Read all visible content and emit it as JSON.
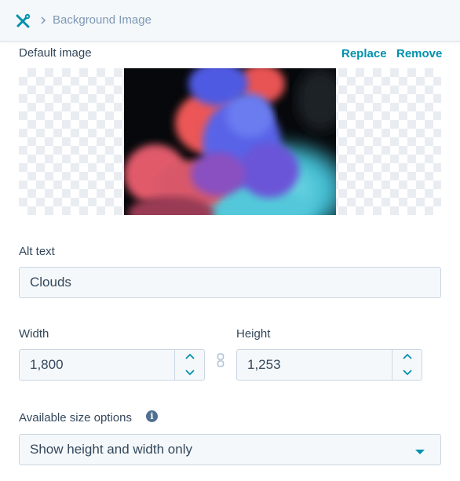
{
  "header": {
    "breadcrumb": "Background Image"
  },
  "image_section": {
    "label": "Default image",
    "replace": "Replace",
    "remove": "Remove"
  },
  "alt_text": {
    "label": "Alt text",
    "value": "Clouds"
  },
  "width": {
    "label": "Width",
    "value": "1,800"
  },
  "height": {
    "label": "Height",
    "value": "1,253"
  },
  "size_options": {
    "label": "Available size options",
    "selected": "Show height and width only"
  },
  "colors": {
    "accent": "#0091ae",
    "text": "#33475b",
    "muted": "#7c98b6",
    "field_bg": "#f5f8fa",
    "border": "#cbd6e2"
  },
  "icons": [
    "tools-icon",
    "chevron-right-icon",
    "link-icon",
    "chevron-up-icon",
    "chevron-down-icon",
    "info-icon",
    "caret-down-icon"
  ]
}
